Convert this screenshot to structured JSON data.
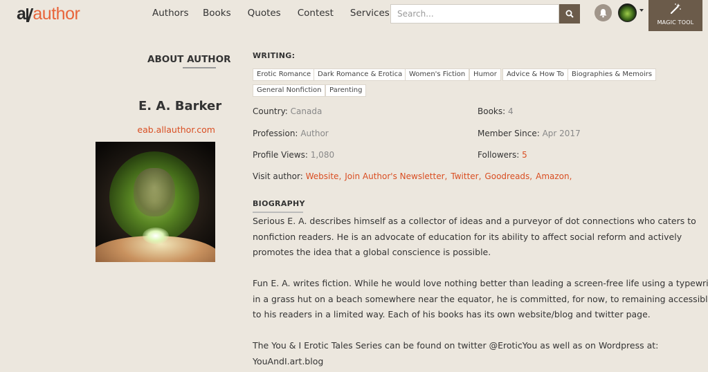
{
  "header": {
    "logo": {
      "prefix": "a",
      "word": "author"
    },
    "nav": [
      "Authors",
      "Books",
      "Quotes",
      "Contest",
      "Services"
    ],
    "search_placeholder": "Search...",
    "magic_tool_label": "MAGIC TOOL"
  },
  "sidebar": {
    "heading": "ABOUT AUTHOR",
    "name": "E. A. Barker",
    "site": "eab.allauthor.com"
  },
  "writing": {
    "heading": "WRITING:",
    "tags": [
      "Erotic Romance",
      "Dark Romance & Erotica",
      "Women's Fiction",
      "Humor",
      "Advice & How To",
      "Biographies & Memoirs",
      "General Nonfiction",
      "Parenting"
    ]
  },
  "stats": {
    "country_label": "Country:",
    "country": "Canada",
    "books_label": "Books:",
    "books": "4",
    "profession_label": "Profession:",
    "profession": "Author",
    "member_label": "Member Since:",
    "member": "Apr 2017",
    "views_label": "Profile Views:",
    "views": "1,080",
    "followers_label": "Followers:",
    "followers": "5"
  },
  "visit": {
    "label": "Visit author:",
    "links": [
      "Website",
      "Join Author's Newsletter",
      "Twitter",
      "Goodreads",
      "Amazon"
    ]
  },
  "biography": {
    "heading": "BIOGRAPHY",
    "p1": [
      "Serious E. A. describes himself as a collector of ideas and a purveyor of dot connections who caters to",
      "nonfiction readers. He is an advocate of education for its ability to affect social reform and actively",
      "promotes the idea that a global conscience is possible."
    ],
    "p2": [
      "Fun E. A. writes fiction. While he would love nothing better than leading a screen-free life using a typewriter",
      "in a grass hut on a beach somewhere near the equator, he is committed, for now, to remaining accessible",
      "to his readers in a limited way. Each of his books has its own website/blog and twitter page."
    ],
    "p3": [
      "The You & I Erotic Tales Series can be found on twitter @EroticYou as well as on Wordpress at:",
      "YouAndI.art.blog"
    ]
  },
  "colors": {
    "accent": "#d94e22",
    "brand_dark": "#6b5b4a",
    "background": "#ece7de"
  },
  "icons": {
    "search": "magnifier-icon",
    "bell": "bell-icon",
    "magic": "magic-wand-icon"
  }
}
